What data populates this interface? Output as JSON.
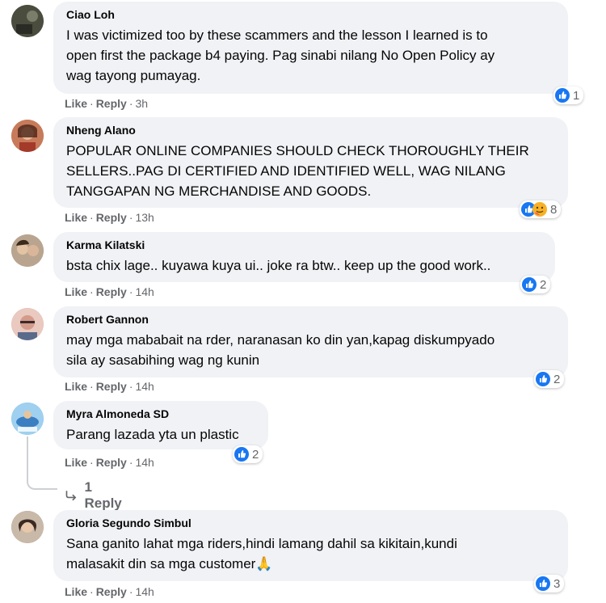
{
  "comments": [
    {
      "author": "Ciao Loh",
      "text": "I was victimized too by these scammers and the lesson I learned is to\nopen first the package b4 paying. Pag sinabi nilang No Open Policy ay\nwag tayong pumayag.",
      "like": "Like",
      "reply": "Reply",
      "time": "3h",
      "reactions": "1",
      "avatar_color": "#3b3d34"
    },
    {
      "author": "Nheng Alano",
      "text": "POPULAR ONLINE COMPANIES SHOULD CHECK THOROUGHLY THEIR\nSELLERS..PAG DI CERTIFIED AND IDENTIFIED WELL, WAG NILANG\nTANGGAPAN NG MERCHANDISE AND GOODS.",
      "like": "Like",
      "reply": "Reply",
      "time": "13h",
      "reactions": "8",
      "avatar_color": "#b85a3a"
    },
    {
      "author": "Karma Kilatski",
      "text": "bsta chix lage.. kuyawa kuya ui.. joke ra btw.. keep up the good work..",
      "like": "Like",
      "reply": "Reply",
      "time": "14h",
      "reactions": "2",
      "avatar_color": "#8a7a6a"
    },
    {
      "author": "Robert Gannon",
      "text": "may mga mababait na rder, naranasan ko din yan,kapag diskumpyado\nsila ay sasabihing wag ng kunin",
      "like": "Like",
      "reply": "Reply",
      "time": "14h",
      "reactions": "2",
      "avatar_color": "#d9a99a"
    },
    {
      "author": "Myra Almoneda SD",
      "text": "Parang lazada yta un plastic",
      "like": "Like",
      "reply": "Reply",
      "time": "14h",
      "reactions": "2",
      "avatar_color": "#6aa7d8"
    },
    {
      "author": "Gloria Segundo Simbul",
      "text": "Sana ganito lahat mga riders,hindi lamang dahil sa kikitain,kundi\nmalasakit din sa mga customer🙏",
      "like": "Like",
      "reply": "Reply",
      "time": "14h",
      "reactions": "3",
      "avatar_color": "#9a8a80"
    }
  ],
  "replies_link": "1 Reply",
  "colors": {
    "like_blue": "#1877f2",
    "haha_yellow": "#f7b125",
    "bubble": "#f0f2f5",
    "meta": "#65676b"
  }
}
